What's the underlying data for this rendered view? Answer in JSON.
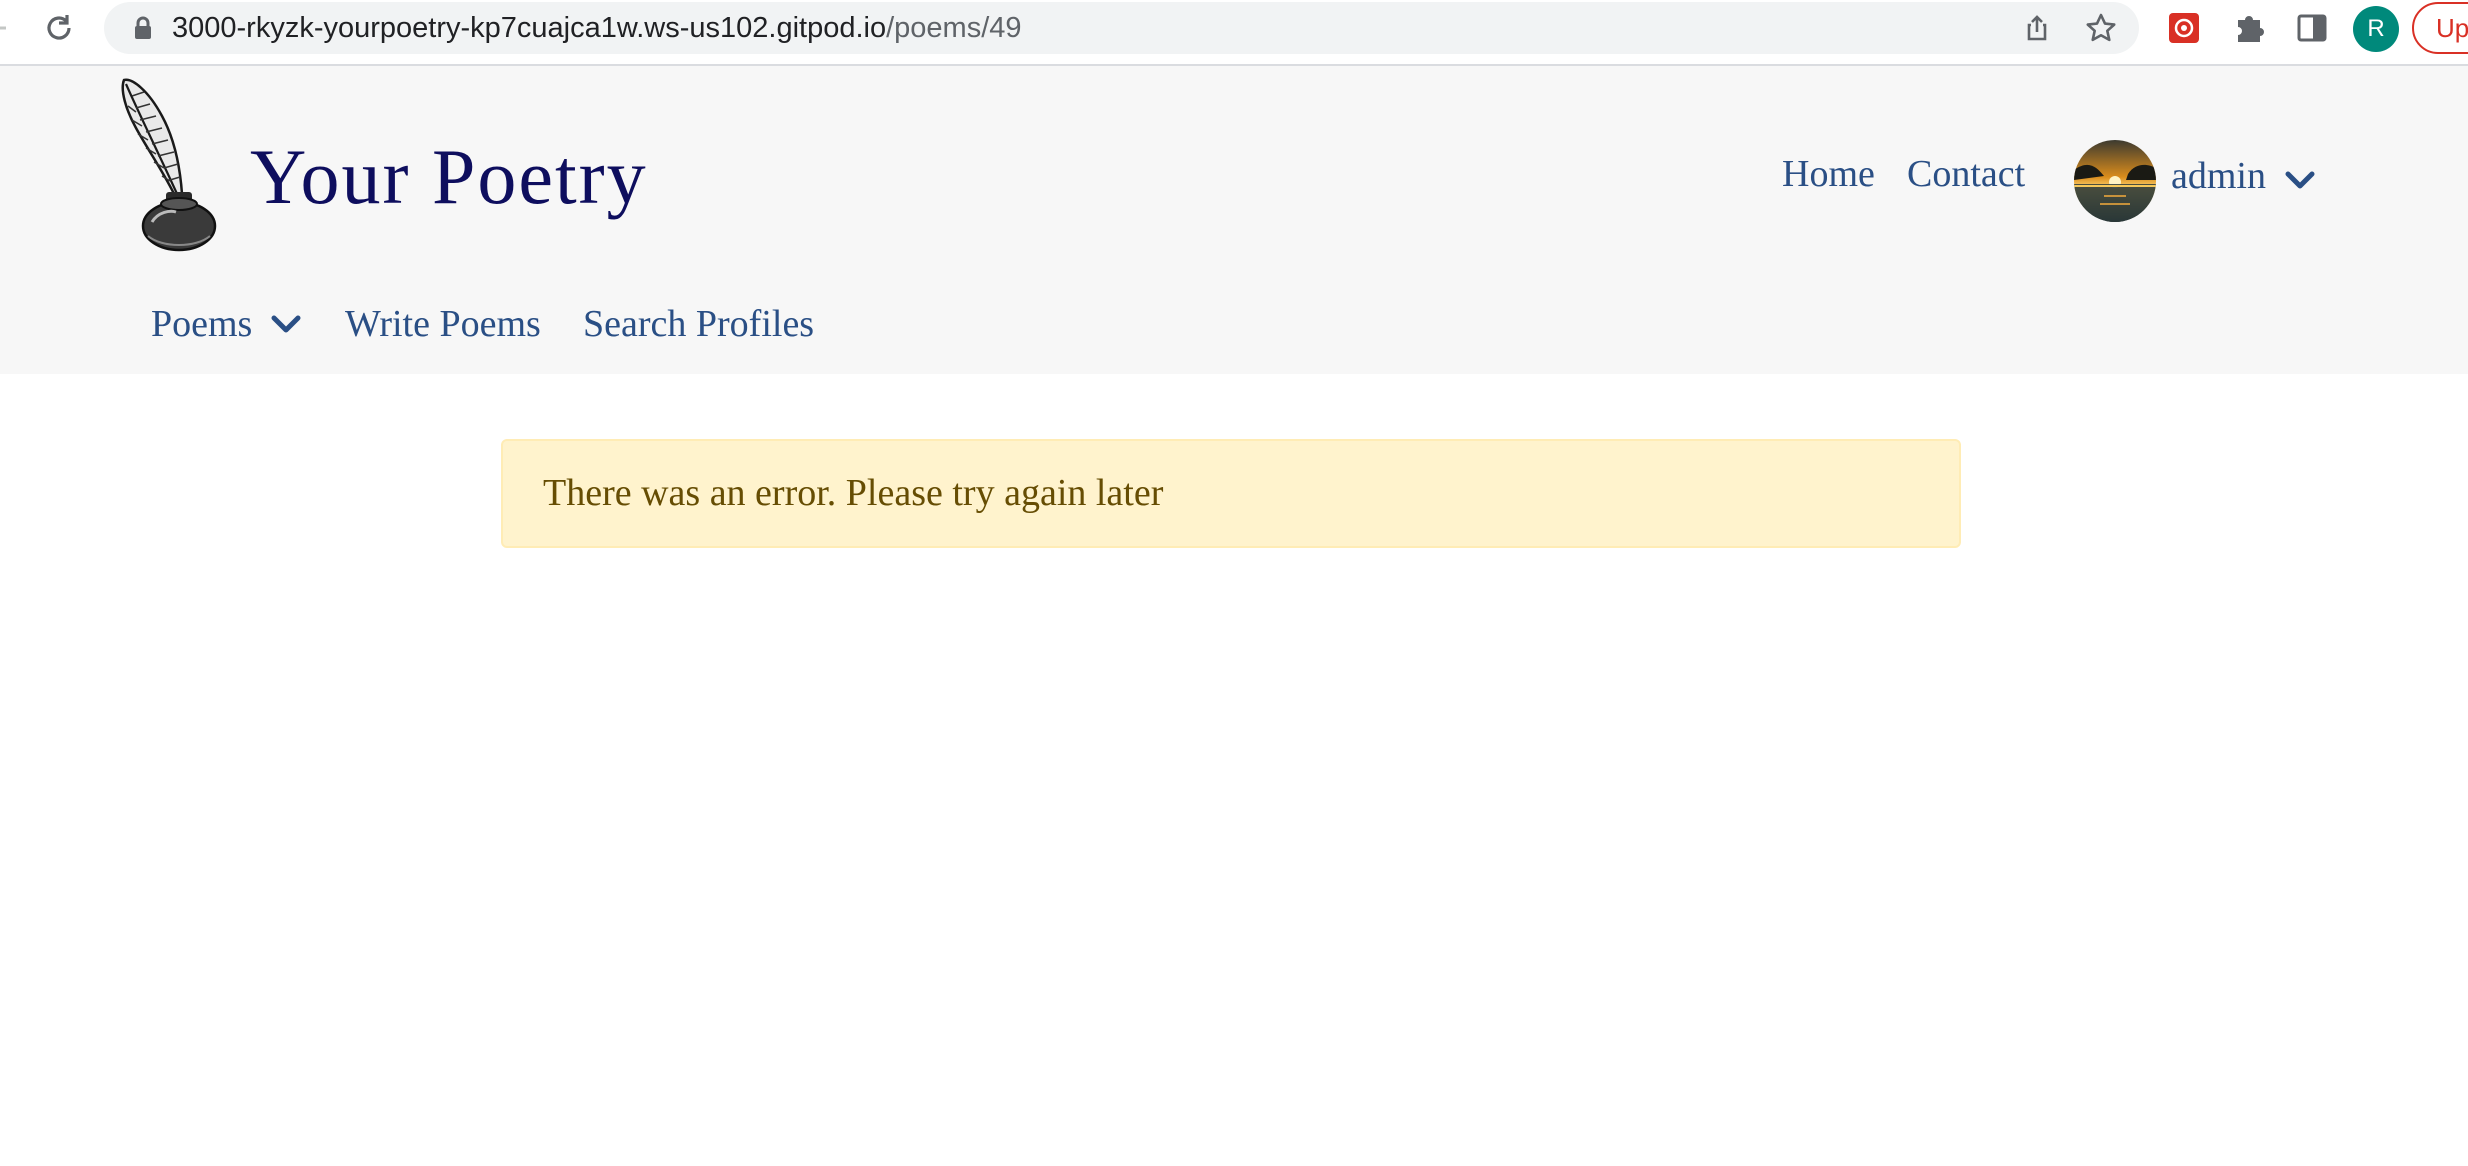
{
  "browser": {
    "url_host": "3000-rkyzk-yourpoetry-kp7cuajca1w.ws-us102.gitpod.io",
    "url_path": "/poems/49",
    "profile_initial": "R",
    "update_label": "Update",
    "icons": [
      "back-arrow-icon",
      "reload-icon",
      "lock-icon",
      "share-icon",
      "star-icon",
      "extension-app-icon",
      "puzzle-icon",
      "side-panel-icon"
    ]
  },
  "header": {
    "brand_title": "Your Poetry",
    "nav_right": {
      "home": "Home",
      "contact": "Contact"
    },
    "user": {
      "name": "admin"
    },
    "nav_sub": {
      "poems": "Poems",
      "write": "Write Poems",
      "search": "Search Profiles"
    }
  },
  "alert": {
    "message": "There was an error. Please try again later",
    "colors": {
      "background": "#fff3cd",
      "border": "#ffecb5",
      "text": "#664d03"
    }
  },
  "colors": {
    "brand": "#0e0e5e",
    "link": "#2a4f85",
    "header_bg": "#f7f7f7"
  }
}
